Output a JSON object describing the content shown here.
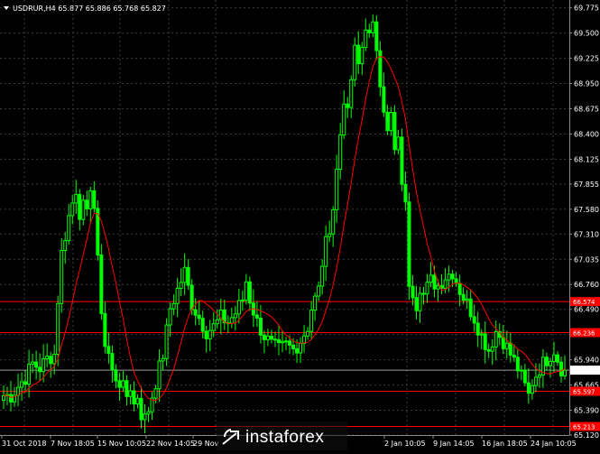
{
  "header": {
    "symbol_line": "USDRUR,H4  65.877 65.886 65.768 65.827"
  },
  "watermark": {
    "text": "instaforex"
  },
  "colors": {
    "background": "#000000",
    "candle": "#00ff00",
    "ma": "#ff0000",
    "level_line": "#ff0000",
    "grid": "#3c3c3c",
    "axis_text": "#ffffff"
  },
  "chart_data": {
    "type": "candlestick",
    "title": "USDRUR,H4",
    "ohlc_last": {
      "open": 65.877,
      "high": 65.886,
      "low": 65.768,
      "close": 65.827
    },
    "ylim": [
      65.12,
      69.86
    ],
    "y_ticks": [
      "69.775",
      "69.500",
      "69.225",
      "68.950",
      "68.675",
      "68.400",
      "68.125",
      "67.855",
      "67.580",
      "67.310",
      "67.035",
      "66.760",
      "66.490",
      "66.215",
      "65.940",
      "65.665",
      "65.390",
      "65.120"
    ],
    "x_ticks": [
      "31 Oct 2018",
      "7 Nov 18:05",
      "15 Nov 10:05",
      "22 Nov 14:05",
      "29 Nov",
      "2 Jan 10:05",
      "9 Jan 14:05",
      "16 Jan 18:05",
      "24 Jan 10:05"
    ],
    "levels": [
      {
        "value": "66.574",
        "price": 66.574
      },
      {
        "value": "66.236",
        "price": 66.236
      },
      {
        "value": "65.827",
        "price": 65.827,
        "current": true
      },
      {
        "value": "65.597",
        "price": 65.597
      },
      {
        "value": "65.213",
        "price": 65.213
      }
    ],
    "grid": true,
    "indicator": "moving average (red line)",
    "anchors": [
      [
        0,
        65.55
      ],
      [
        2,
        65.55
      ],
      [
        4,
        65.65
      ],
      [
        6,
        65.75
      ],
      [
        8,
        65.9
      ],
      [
        10,
        65.85
      ],
      [
        12,
        65.95
      ],
      [
        14,
        66.0
      ],
      [
        15,
        66.6
      ],
      [
        16,
        67.1
      ],
      [
        18,
        67.5
      ],
      [
        20,
        67.8
      ],
      [
        21,
        67.55
      ],
      [
        22,
        67.6
      ],
      [
        23,
        67.5
      ],
      [
        24,
        67.85
      ],
      [
        25,
        67.6
      ],
      [
        26,
        67.0
      ],
      [
        27,
        66.5
      ],
      [
        28,
        66.1
      ],
      [
        29,
        66.0
      ],
      [
        30,
        65.8
      ],
      [
        32,
        65.7
      ],
      [
        34,
        65.55
      ],
      [
        35,
        65.65
      ],
      [
        36,
        65.45
      ],
      [
        37,
        65.55
      ],
      [
        38,
        65.35
      ],
      [
        39,
        65.3
      ],
      [
        40,
        65.4
      ],
      [
        42,
        65.7
      ],
      [
        44,
        66.0
      ],
      [
        46,
        66.5
      ],
      [
        48,
        66.7
      ],
      [
        50,
        66.9
      ],
      [
        52,
        66.55
      ],
      [
        54,
        66.4
      ],
      [
        56,
        66.25
      ],
      [
        58,
        66.3
      ],
      [
        60,
        66.4
      ],
      [
        62,
        66.35
      ],
      [
        64,
        66.45
      ],
      [
        66,
        66.6
      ],
      [
        67,
        66.8
      ],
      [
        68,
        66.6
      ],
      [
        70,
        66.35
      ],
      [
        72,
        66.2
      ],
      [
        74,
        66.1
      ],
      [
        76,
        66.05
      ],
      [
        78,
        66.1
      ],
      [
        80,
        66.05
      ],
      [
        82,
        66.15
      ],
      [
        84,
        66.3
      ],
      [
        85,
        66.5
      ],
      [
        86,
        66.6
      ],
      [
        87,
        66.7
      ],
      [
        88,
        67.0
      ],
      [
        89,
        67.2
      ],
      [
        90,
        67.4
      ],
      [
        91,
        67.6
      ],
      [
        92,
        68.0
      ],
      [
        93,
        68.4
      ],
      [
        94,
        68.8
      ],
      [
        95,
        68.6
      ],
      [
        96,
        69.0
      ],
      [
        97,
        69.3
      ],
      [
        98,
        69.15
      ],
      [
        99,
        69.35
      ],
      [
        100,
        69.6
      ],
      [
        101,
        69.45
      ],
      [
        102,
        69.55
      ],
      [
        103,
        69.35
      ],
      [
        104,
        69.0
      ],
      [
        105,
        68.7
      ],
      [
        106,
        68.4
      ],
      [
        107,
        68.6
      ],
      [
        108,
        68.2
      ],
      [
        109,
        68.3
      ],
      [
        110,
        67.9
      ],
      [
        111,
        67.6
      ],
      [
        112,
        66.8
      ],
      [
        113,
        66.7
      ],
      [
        114,
        66.55
      ],
      [
        115,
        66.75
      ],
      [
        116,
        66.65
      ],
      [
        118,
        66.8
      ],
      [
        120,
        66.75
      ],
      [
        122,
        66.85
      ],
      [
        124,
        66.9
      ],
      [
        126,
        66.7
      ],
      [
        128,
        66.55
      ],
      [
        130,
        66.4
      ],
      [
        132,
        66.2
      ],
      [
        134,
        66.05
      ],
      [
        136,
        66.25
      ],
      [
        138,
        66.15
      ],
      [
        140,
        66.0
      ],
      [
        142,
        65.85
      ],
      [
        144,
        65.65
      ],
      [
        145,
        65.55
      ],
      [
        146,
        65.7
      ],
      [
        148,
        65.85
      ],
      [
        150,
        65.95
      ],
      [
        152,
        66.05
      ],
      [
        154,
        65.85
      ],
      [
        155,
        65.827
      ]
    ]
  }
}
